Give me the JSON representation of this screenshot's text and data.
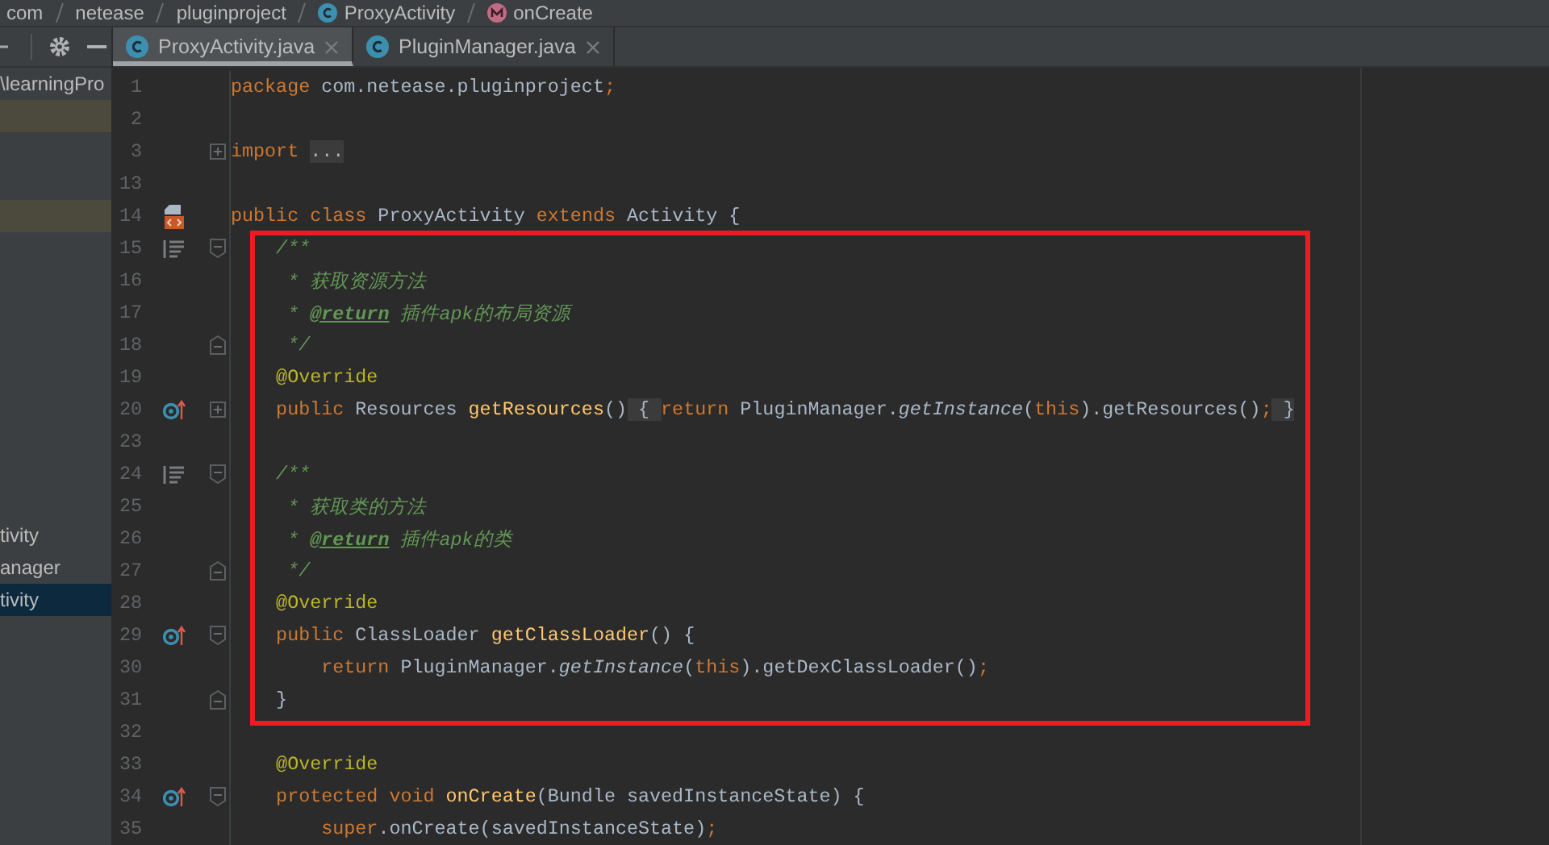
{
  "breadcrumb": [
    {
      "text": "com",
      "kind": "package"
    },
    {
      "text": "netease",
      "kind": "package"
    },
    {
      "text": "pluginproject",
      "kind": "package"
    },
    {
      "text": "ProxyActivity",
      "kind": "class"
    },
    {
      "text": "onCreate",
      "kind": "method"
    }
  ],
  "project_panel": {
    "top_items": [
      {
        "kind": "text",
        "text": "\\learningPro",
        "selected": false
      },
      {
        "kind": "marked",
        "selected": false
      },
      {
        "kind": "marked",
        "selected": false
      }
    ],
    "lower_items": [
      {
        "kind": "text",
        "text": "tivity",
        "selected": false
      },
      {
        "kind": "text",
        "text": "anager",
        "selected": false
      },
      {
        "kind": "text",
        "text": "tivity",
        "selected": true
      }
    ]
  },
  "tabs": [
    {
      "label": "ProxyActivity.java",
      "selected": true
    },
    {
      "label": "PluginManager.java",
      "selected": false
    }
  ],
  "editor": {
    "blocks": [
      {
        "highlighted": false,
        "lines": [
          {
            "number": "1",
            "tokens": [
              {
                "kind": "kw",
                "text": "package"
              },
              {
                "kind": "plain",
                "text": " com.netease.pluginproject"
              },
              {
                "kind": "punct",
                "text": ";"
              }
            ]
          },
          {
            "number": "2"
          },
          {
            "number": "3",
            "fold_marker": {
              "kind": "collapsed"
            },
            "tokens": [
              {
                "kind": "kw",
                "text": "import "
              },
              {
                "kind": "fold",
                "text": "..."
              }
            ]
          },
          {
            "number": "13"
          },
          {
            "number": "14",
            "gutter_icon": {
              "kind": "layout"
            },
            "tokens": [
              {
                "kind": "kw",
                "text": "public class"
              },
              {
                "kind": "plain",
                "text": " ProxyActivity "
              },
              {
                "kind": "kw",
                "text": "extends"
              },
              {
                "kind": "plain",
                "text": " Activity {"
              }
            ]
          }
        ]
      },
      {
        "highlighted": true,
        "lines": [
          {
            "number": "15",
            "gutter_icon": {
              "kind": "doc"
            },
            "fold_marker": {
              "kind": "open"
            },
            "tokens": [
              {
                "kind": "comment",
                "text": "    /**"
              }
            ]
          },
          {
            "number": "16",
            "tokens": [
              {
                "kind": "comment",
                "text": "     * 获取资源方法"
              }
            ]
          },
          {
            "number": "17",
            "tokens": [
              {
                "kind": "comment",
                "text": "     * "
              },
              {
                "kind": "doctag",
                "text": "@return"
              },
              {
                "kind": "comment",
                "text": " 插件apk的布局资源"
              }
            ]
          },
          {
            "number": "18",
            "fold_marker": {
              "kind": "end"
            },
            "tokens": [
              {
                "kind": "comment",
                "text": "     */"
              }
            ]
          },
          {
            "number": "19",
            "tokens": [
              {
                "kind": "annotation",
                "text": "    @Override"
              }
            ]
          },
          {
            "number": "20",
            "gutter_icon": {
              "kind": "override"
            },
            "fold_marker": {
              "kind": "collapsed"
            },
            "tokens": [
              {
                "kind": "kw",
                "text": "    public"
              },
              {
                "kind": "plain",
                "text": " Resources "
              },
              {
                "kind": "decl",
                "text": "getResources"
              },
              {
                "kind": "plain",
                "text": "()"
              },
              {
                "kind": "fold",
                "text": " { "
              },
              {
                "kind": "kw",
                "text": "return"
              },
              {
                "kind": "plain",
                "text": " PluginManager."
              },
              {
                "kind": "static",
                "text": "getInstance"
              },
              {
                "kind": "plain",
                "text": "("
              },
              {
                "kind": "kw",
                "text": "this"
              },
              {
                "kind": "plain",
                "text": ").getResources()"
              },
              {
                "kind": "punct",
                "text": ";"
              },
              {
                "kind": "fold",
                "text": " }"
              }
            ]
          },
          {
            "number": "23"
          },
          {
            "number": "24",
            "gutter_icon": {
              "kind": "doc"
            },
            "fold_marker": {
              "kind": "open"
            },
            "tokens": [
              {
                "kind": "comment",
                "text": "    /**"
              }
            ]
          },
          {
            "number": "25",
            "tokens": [
              {
                "kind": "comment",
                "text": "     * 获取类的方法"
              }
            ]
          },
          {
            "number": "26",
            "tokens": [
              {
                "kind": "comment",
                "text": "     * "
              },
              {
                "kind": "doctag",
                "text": "@return"
              },
              {
                "kind": "comment",
                "text": " 插件apk的类"
              }
            ]
          },
          {
            "number": "27",
            "fold_marker": {
              "kind": "end"
            },
            "tokens": [
              {
                "kind": "comment",
                "text": "     */"
              }
            ]
          },
          {
            "number": "28",
            "tokens": [
              {
                "kind": "annotation",
                "text": "    @Override"
              }
            ]
          },
          {
            "number": "29",
            "gutter_icon": {
              "kind": "override"
            },
            "fold_marker": {
              "kind": "open"
            },
            "tokens": [
              {
                "kind": "kw",
                "text": "    public"
              },
              {
                "kind": "plain",
                "text": " ClassLoader "
              },
              {
                "kind": "decl",
                "text": "getClassLoader"
              },
              {
                "kind": "plain",
                "text": "() {"
              }
            ]
          },
          {
            "number": "30",
            "tokens": [
              {
                "kind": "kw",
                "text": "        return"
              },
              {
                "kind": "plain",
                "text": " PluginManager."
              },
              {
                "kind": "static",
                "text": "getInstance"
              },
              {
                "kind": "plain",
                "text": "("
              },
              {
                "kind": "kw",
                "text": "this"
              },
              {
                "kind": "plain",
                "text": ").getDexClassLoader()"
              },
              {
                "kind": "punct",
                "text": ";"
              }
            ]
          },
          {
            "number": "31",
            "fold_marker": {
              "kind": "end"
            },
            "tokens": [
              {
                "kind": "plain",
                "text": "    }"
              }
            ]
          }
        ]
      },
      {
        "highlighted": false,
        "lines": [
          {
            "number": "32"
          },
          {
            "number": "33",
            "tokens": [
              {
                "kind": "annotation",
                "text": "    @Override"
              }
            ]
          },
          {
            "number": "34",
            "gutter_icon": {
              "kind": "override"
            },
            "fold_marker": {
              "kind": "open"
            },
            "tokens": [
              {
                "kind": "kw",
                "text": "    protected void "
              },
              {
                "kind": "decl",
                "text": "onCreate"
              },
              {
                "kind": "plain",
                "text": "(Bundle savedInstanceState) {"
              }
            ]
          },
          {
            "number": "35",
            "tokens": [
              {
                "kind": "kw",
                "text": "        super"
              },
              {
                "kind": "plain",
                "text": ".onCreate(savedInstanceState)"
              },
              {
                "kind": "punct",
                "text": ";"
              }
            ]
          }
        ]
      }
    ]
  }
}
